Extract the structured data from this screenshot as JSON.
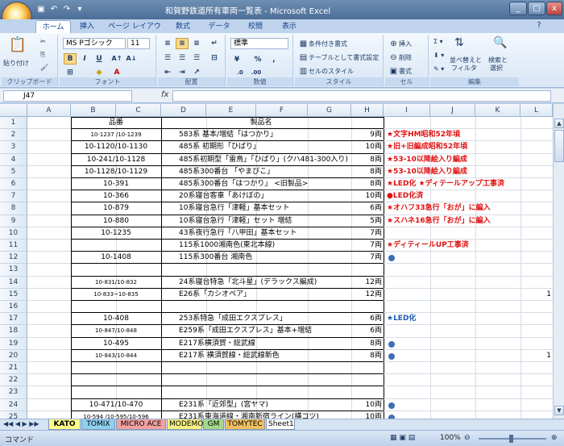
{
  "window": {
    "title": "和賀野鉄道所有車両一覧表 - Microsoft Excel",
    "min": "_",
    "max": "□",
    "close": "x"
  },
  "ribbon_tabs": [
    "ホーム",
    "挿入",
    "ページ レイアウト",
    "数式",
    "データ",
    "校閲",
    "表示"
  ],
  "ribbon": {
    "clipboard": {
      "label": "クリップボード",
      "paste": "貼り付け"
    },
    "font": {
      "label": "フォント",
      "name": "MS Pゴシック",
      "size": "11",
      "bold": "B",
      "italic": "I",
      "underline": "U"
    },
    "alignment": {
      "label": "配置"
    },
    "number": {
      "label": "数値",
      "format": "標準"
    },
    "styles": {
      "label": "スタイル",
      "conditional": "条件付き書式",
      "table": "テーブルとして書式設定",
      "cell_styles": "セルのスタイル"
    },
    "cells": {
      "label": "セル",
      "insert": "挿入",
      "delete": "削除",
      "format": "書式"
    },
    "editing": {
      "label": "編集",
      "sort": "並べ替えと",
      "filter": "フィルタ",
      "find": "検索と",
      "select": "選択"
    }
  },
  "formula_bar": {
    "name_box": "J47",
    "fx": "fx",
    "content": ""
  },
  "columns": [
    "A",
    "B",
    "C",
    "D",
    "E",
    "F",
    "G",
    "H",
    "I",
    "J",
    "K",
    "L"
  ],
  "rows": [
    {
      "n": "1",
      "num": "品番",
      "name": "製品名",
      "qty": "",
      "note": "",
      "style": "header"
    },
    {
      "n": "2",
      "num": "10-1237 /10-1239",
      "name": "583系 基本/増結「はつかり」",
      "qty": "9両",
      "note": "★文字HM昭和52年頃",
      "style": "red",
      "small": true
    },
    {
      "n": "3",
      "num": "10-1120/10-1130",
      "name": "485系 初期形「ひばり」",
      "qty": "10両",
      "note": "★旧+旧編成昭和52年頃",
      "style": "red"
    },
    {
      "n": "4",
      "num": "10-241/10-1128",
      "name": "485系初期型「雷鳥」「ひばり」(クハ481-300入り)",
      "qty": "8両",
      "note": "★53-10以降絵入り編成",
      "style": "red"
    },
    {
      "n": "5",
      "num": "10-1128/10-1129",
      "name": "485系300番台 「やまびこ」",
      "qty": "8両",
      "note": "★53-10以降絵入り編成",
      "style": "red"
    },
    {
      "n": "6",
      "num": "10-391",
      "name": "485系300番台「はつかり」 <旧製品>",
      "qty": "8両",
      "note": "★LED化 ★ディテールアップ工事済",
      "style": "red"
    },
    {
      "n": "7",
      "num": "10-366",
      "name": "20系寝台客車「あけぼの」",
      "qty": "10両",
      "note": "●LED化済",
      "style": "red"
    },
    {
      "n": "8",
      "num": "10-879",
      "name": "10系寝台急行「津軽」基本セット",
      "qty": "6両",
      "note": "★オハフ33急行「おが」に編入",
      "style": "red"
    },
    {
      "n": "9",
      "num": "10-880",
      "name": "10系寝台急行「津軽」セット 増結",
      "qty": "5両",
      "note": "★スハネ16急行「おが」に編入",
      "style": "red"
    },
    {
      "n": "10",
      "num": "10-1235",
      "name": "43系夜行急行「八甲田」基本セット",
      "qty": "7両",
      "note": "",
      "style": ""
    },
    {
      "n": "11",
      "num": "",
      "name": "115系1000湘南色(東北本線)",
      "qty": "7両",
      "note": "★ディティールUP工事済",
      "style": "red"
    },
    {
      "n": "12",
      "num": "10-1408",
      "name": "115系300番台 湘南色",
      "qty": "7両",
      "note": "dot",
      "style": ""
    },
    {
      "n": "13",
      "num": "",
      "name": "",
      "qty": "",
      "note": "",
      "style": ""
    },
    {
      "n": "14",
      "num": "10-831/10-832",
      "name": "24系寝台特急「北斗星」(デラックス編成)",
      "qty": "12両",
      "note": "",
      "style": "",
      "small": true
    },
    {
      "n": "15",
      "num": "10-833~10-835",
      "name": "E26系「カシオペア」",
      "qty": "12両",
      "note": "",
      "style": "",
      "small": true,
      "extra": "1"
    },
    {
      "n": "16",
      "num": "",
      "name": "",
      "qty": "",
      "note": "",
      "style": ""
    },
    {
      "n": "17",
      "num": "10-408",
      "name": "253系特急「成田エクスプレス」",
      "qty": "6両",
      "note": "★LED化",
      "style": "blue"
    },
    {
      "n": "18",
      "num": "10-847/10-848",
      "name": "E259系「成田エクスプレス」基本+増結",
      "qty": "6両",
      "note": "",
      "style": "",
      "small": true
    },
    {
      "n": "19",
      "num": "10-495",
      "name": "E217系横須賀・総武線",
      "qty": "8両",
      "note": "dot",
      "style": ""
    },
    {
      "n": "20",
      "num": "10-843/10-844",
      "name": "E217系 横須賀線・総武線新色",
      "qty": "8両",
      "note": "dot",
      "style": "",
      "small": true,
      "extra": "1"
    },
    {
      "n": "21",
      "num": "",
      "name": "",
      "qty": "",
      "note": "",
      "style": ""
    },
    {
      "n": "22",
      "num": "",
      "name": "",
      "qty": "",
      "note": "",
      "style": ""
    },
    {
      "n": "23",
      "num": "",
      "name": "",
      "qty": "",
      "note": "",
      "style": ""
    },
    {
      "n": "24",
      "num": "10-471/10-470",
      "name": "E231系「近郊型」(宮ヤマ)",
      "qty": "10両",
      "note": "dot",
      "style": ""
    },
    {
      "n": "25",
      "num": "10-594 /10-595/10-596",
      "name": "E231系東海道線・湘南新宿ライン(横コツ)",
      "qty": "10両",
      "note": "dot",
      "style": "",
      "small": true
    }
  ],
  "sheets": [
    "KATO",
    "TOMIX",
    "MICRO ACE",
    "MODEMO",
    "GM",
    "TOMYTEC",
    "Sheet1"
  ],
  "sheet_colors": [
    "#f6f6a0",
    "#8fd0f0",
    "#f4a0a0",
    "#f8f080",
    "#a6d88a",
    "#f0c060",
    "#ffffff"
  ],
  "status": {
    "mode": "コマンド",
    "zoom": "100%"
  },
  "icons": {
    "save": "save-icon",
    "undo": "undo-icon",
    "redo": "redo-icon"
  }
}
